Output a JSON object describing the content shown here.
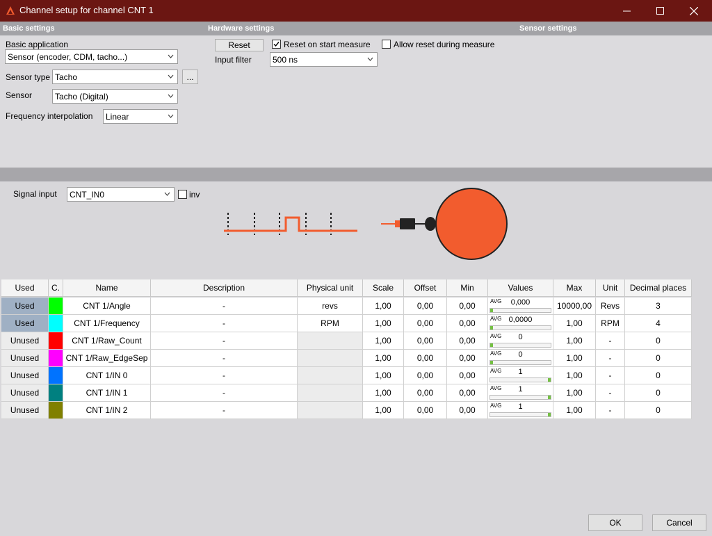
{
  "window": {
    "title": "Channel setup for channel CNT 1"
  },
  "sections": {
    "basic": "Basic settings",
    "hardware": "Hardware settings",
    "sensor": "Sensor settings"
  },
  "basic": {
    "application_label": "Basic application",
    "application_value": "Sensor (encoder, CDM, tacho...)",
    "sensor_type_label": "Sensor type",
    "sensor_type_value": "Tacho",
    "browse_label": "...",
    "sensor_label": "Sensor",
    "sensor_value": "Tacho (Digital)",
    "interp_label": "Frequency interpolation",
    "interp_value": "Linear"
  },
  "hardware": {
    "reset_label": "Reset",
    "reset_on_start_label": "Reset on start measure",
    "reset_on_start_checked": true,
    "allow_reset_label": "Allow reset during measure",
    "allow_reset_checked": false,
    "input_filter_label": "Input filter",
    "input_filter_value": "500 ns"
  },
  "signal": {
    "label": "Signal input",
    "value": "CNT_IN0",
    "inv_label": "inv",
    "inv_checked": false
  },
  "colors": {
    "accent": "#f25c2e",
    "titlebar": "#6b1612"
  },
  "table": {
    "headers": [
      "Used",
      "C.",
      "Name",
      "Description",
      "Physical unit",
      "Scale",
      "Offset",
      "Min",
      "Values",
      "Max",
      "Unit",
      "Decimal places"
    ],
    "rows": [
      {
        "used": "Used",
        "color": "#00ff00",
        "name": "CNT 1/Angle",
        "description": "-",
        "physical_unit": "revs",
        "scale": "1,00",
        "offset": "0,00",
        "min": "0,00",
        "avg_label": "AVG",
        "value": "0,000",
        "level": 0.0,
        "max": "10000,00",
        "unit": "Revs",
        "decimals": "3"
      },
      {
        "used": "Used",
        "color": "#00ffff",
        "name": "CNT 1/Frequency",
        "description": "-",
        "physical_unit": "RPM",
        "scale": "1,00",
        "offset": "0,00",
        "min": "0,00",
        "avg_label": "AVG",
        "value": "0,0000",
        "level": 0.0,
        "max": "1,00",
        "unit": "RPM",
        "decimals": "4"
      },
      {
        "used": "Unused",
        "color": "#ff0000",
        "name": "CNT 1/Raw_Count",
        "description": "-",
        "physical_unit": "",
        "scale": "1,00",
        "offset": "0,00",
        "min": "0,00",
        "avg_label": "AVG",
        "value": "0",
        "level": 0.0,
        "max": "1,00",
        "unit": "-",
        "decimals": "0"
      },
      {
        "used": "Unused",
        "color": "#ff00ff",
        "name": "CNT 1/Raw_EdgeSep",
        "description": "-",
        "physical_unit": "",
        "scale": "1,00",
        "offset": "0,00",
        "min": "0,00",
        "avg_label": "AVG",
        "value": "0",
        "level": 0.0,
        "max": "1,00",
        "unit": "-",
        "decimals": "0"
      },
      {
        "used": "Unused",
        "color": "#0073ff",
        "name": "CNT 1/IN 0",
        "description": "-",
        "physical_unit": "",
        "scale": "1,00",
        "offset": "0,00",
        "min": "0,00",
        "avg_label": "AVG",
        "value": "1",
        "level": 1.0,
        "max": "1,00",
        "unit": "-",
        "decimals": "0"
      },
      {
        "used": "Unused",
        "color": "#008080",
        "name": "CNT 1/IN 1",
        "description": "-",
        "physical_unit": "",
        "scale": "1,00",
        "offset": "0,00",
        "min": "0,00",
        "avg_label": "AVG",
        "value": "1",
        "level": 1.0,
        "max": "1,00",
        "unit": "-",
        "decimals": "0"
      },
      {
        "used": "Unused",
        "color": "#808000",
        "name": "CNT 1/IN 2",
        "description": "-",
        "physical_unit": "",
        "scale": "1,00",
        "offset": "0,00",
        "min": "0,00",
        "avg_label": "AVG",
        "value": "1",
        "level": 1.0,
        "max": "1,00",
        "unit": "-",
        "decimals": "0"
      }
    ]
  },
  "footer": {
    "ok_label": "OK",
    "cancel_label": "Cancel"
  }
}
